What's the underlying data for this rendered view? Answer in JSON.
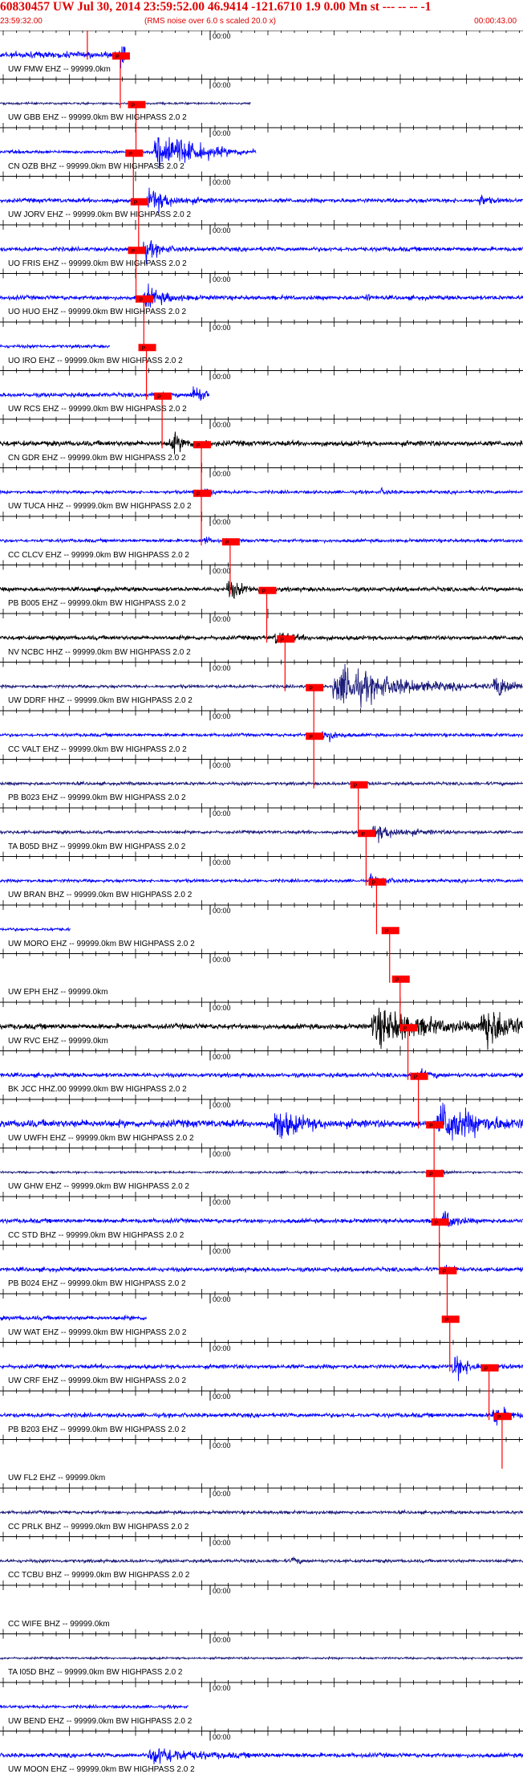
{
  "header": {
    "title": "60830457 UW Jul 30, 2014 23:59:52.00   46.9414 -121.6710  1.9 0.00 Mn st --- -- --   -1",
    "start_time": "23:59:32.00",
    "note": "(RMS noise over 6.0 s scaled 20.0 x)",
    "end_time": "00:00:43.00"
  },
  "chart_data": {
    "type": "line",
    "title": "60830457 UW Jul 30, 2014 23:59:52.00   46.9414 -121.6710  1.9 0.00 Mn st --- -- --   -1",
    "x_range": [
      "23:59:32.00",
      "00:00:43.00"
    ],
    "tick_label": "00:00",
    "pick_label": "P",
    "colors": {
      "pick": "#ff0000",
      "blue": "#0000ff",
      "black": "#000000",
      "navy": "#1a1a7a"
    },
    "traces": [
      {
        "label": "UW FMW EHZ -- 99999.0km",
        "color": "blue",
        "pick": 0.167,
        "amp": 6,
        "end": 0.24,
        "events": [
          [
            0.23,
            14,
            0.01
          ]
        ]
      },
      {
        "label": "UW GBB EHZ -- 99999.0km BW  HIGHPASS  2.0  2",
        "color": "navy",
        "pick": 0.23,
        "amp": 2,
        "end": 0.48,
        "events": []
      },
      {
        "label": "CN OZB BHZ -- 99999.0km BW  HIGHPASS  2.0  2",
        "color": "blue",
        "pick": 0.26,
        "amp": 3,
        "end": 0.49,
        "events": [
          [
            0.31,
            24,
            0.05
          ]
        ]
      },
      {
        "label": "UW JORV EHZ -- 99999.0km BW  HIGHPASS  2.0  2",
        "color": "blue",
        "pick": 0.255,
        "amp": 4,
        "end": 1.0,
        "events": [
          [
            0.29,
            12,
            0.03
          ],
          [
            0.92,
            6,
            0.01
          ]
        ]
      },
      {
        "label": "UO FRIS EHZ -- 99999.0km BW  HIGHPASS  2.0  2",
        "color": "blue",
        "pick": 0.265,
        "amp": 4,
        "end": 1.0,
        "events": [
          [
            0.28,
            10,
            0.02
          ]
        ]
      },
      {
        "label": "UO HUO EHZ -- 99999.0km BW  HIGHPASS  2.0  2",
        "color": "blue",
        "pick": 0.26,
        "amp": 4,
        "end": 1.0,
        "events": [
          [
            0.28,
            12,
            0.025
          ],
          [
            0.7,
            5,
            0.005
          ]
        ]
      },
      {
        "label": "UO IRO EHZ -- 99999.0km BW  HIGHPASS  2.0  2",
        "color": "blue",
        "pick": 0.275,
        "amp": 3,
        "end": 0.21,
        "events": []
      },
      {
        "label": "UW RCS EHZ -- 99999.0km BW  HIGHPASS  2.0  2",
        "color": "blue",
        "pick": 0.28,
        "amp": 4,
        "end": 0.4,
        "events": [
          [
            0.37,
            12,
            0.015
          ]
        ]
      },
      {
        "label": "CN GDR EHZ -- 99999.0km BW  HIGHPASS  2.0  2",
        "color": "black",
        "pick": 0.31,
        "amp": 5,
        "end": 1.0,
        "events": [
          [
            0.33,
            10,
            0.02
          ]
        ]
      },
      {
        "label": "UW TUCA HHZ -- 99999.0km BW  HIGHPASS  2.0  2",
        "color": "blue",
        "pick": 0.385,
        "amp": 3,
        "end": 1.0,
        "events": [
          [
            0.39,
            6,
            0.01
          ],
          [
            0.73,
            3,
            0.01
          ]
        ]
      },
      {
        "label": "CC CLCV EHZ -- 99999.0km BW  HIGHPASS  2.0  2",
        "color": "blue",
        "pick": 0.385,
        "amp": 3,
        "end": 1.0,
        "events": [
          [
            0.39,
            5,
            0.01
          ]
        ]
      },
      {
        "label": "PB B005 EHZ -- 99999.0km BW  HIGHPASS  2.0  2",
        "color": "black",
        "pick": 0.44,
        "amp": 4,
        "end": 1.0,
        "events": [
          [
            0.44,
            10,
            0.02
          ]
        ]
      },
      {
        "label": "NV NCBC HHZ -- 99999.0km BW  HIGHPASS  2.0  2",
        "color": "black",
        "pick": 0.51,
        "amp": 4,
        "end": 1.0,
        "events": [
          [
            0.53,
            8,
            0.02
          ]
        ]
      },
      {
        "label": "UW DDRF HHZ -- 99999.0km BW  HIGHPASS  2.0  2",
        "color": "navy",
        "pick": 0.545,
        "amp": 3,
        "end": 1.0,
        "events": [
          [
            0.66,
            22,
            0.08
          ],
          [
            0.95,
            14,
            0.02
          ]
        ]
      },
      {
        "label": "CC VALT EHZ -- 99999.0km BW  HIGHPASS  2.0  2",
        "color": "blue",
        "pick": 0.6,
        "amp": 3,
        "end": 1.0,
        "events": [
          [
            0.62,
            8,
            0.015
          ]
        ]
      },
      {
        "label": "PB B023 EHZ -- 99999.0km BW  HIGHPASS  2.0  2",
        "color": "navy",
        "pick": 0.6,
        "amp": 3,
        "end": 1.0,
        "events": []
      },
      {
        "label": "TA B05D BHZ -- 99999.0km BW  HIGHPASS  2.0  2",
        "color": "navy",
        "pick": 0.685,
        "amp": 3,
        "end": 1.0,
        "events": [
          [
            0.72,
            8,
            0.04
          ]
        ]
      },
      {
        "label": "UW BRAN BHZ -- 99999.0km BW  HIGHPASS  2.0  2",
        "color": "blue",
        "pick": 0.7,
        "amp": 3,
        "end": 1.0,
        "events": [
          [
            0.71,
            6,
            0.02
          ]
        ]
      },
      {
        "label": "UW MORO EHZ -- 99999.0km BW  HIGHPASS  2.0  2",
        "color": "blue",
        "pick": 0.72,
        "amp": 3,
        "end": 0.135,
        "events": []
      },
      {
        "label": "UW EPH EHZ -- 99999.0km",
        "color": "blue",
        "pick": 0.745,
        "amp": 0,
        "end": 0.0,
        "events": []
      },
      {
        "label": "UW RVC EHZ -- 99999.0km",
        "color": "black",
        "pick": 0.765,
        "amp": 5,
        "end": 1.0,
        "events": [
          [
            0.73,
            20,
            0.07
          ],
          [
            0.93,
            24,
            0.04
          ]
        ]
      },
      {
        "label": "BK JCC HHZ.00 99999.0km BW  HIGHPASS  2.0  2",
        "color": "blue",
        "pick": 0.78,
        "amp": 4,
        "end": 1.0,
        "events": [
          [
            0.8,
            6,
            0.015
          ]
        ]
      },
      {
        "label": "UW UWFH EHZ -- 99999.0km BW  HIGHPASS  2.0  2",
        "color": "blue",
        "pick": 0.8,
        "amp": 7,
        "end": 1.0,
        "events": [
          [
            0.53,
            18,
            0.03
          ],
          [
            0.85,
            22,
            0.05
          ]
        ]
      },
      {
        "label": "UW GHW EHZ -- 99999.0km BW  HIGHPASS  2.0  2",
        "color": "navy",
        "pick": 0.83,
        "amp": 2,
        "end": 1.0,
        "events": [
          [
            0.84,
            5,
            0.01
          ]
        ]
      },
      {
        "label": "CC STD BHZ -- 99999.0km BW  HIGHPASS  2.0  2",
        "color": "blue",
        "pick": 0.83,
        "amp": 4,
        "end": 1.0,
        "events": [
          [
            0.85,
            12,
            0.015
          ]
        ]
      },
      {
        "label": "PB B024 EHZ -- 99999.0km BW  HIGHPASS  2.0  2",
        "color": "blue",
        "pick": 0.84,
        "amp": 4,
        "end": 1.0,
        "events": [
          [
            0.85,
            8,
            0.01
          ]
        ]
      },
      {
        "label": "UW WAT EHZ -- 99999.0km BW  HIGHPASS  2.0  2",
        "color": "blue",
        "pick": 0.855,
        "amp": 4,
        "end": 0.28,
        "events": []
      },
      {
        "label": "UW CRF EHZ -- 99999.0km BW  HIGHPASS  2.0  2",
        "color": "blue",
        "pick": 0.86,
        "amp": 4,
        "end": 1.0,
        "events": [
          [
            0.87,
            14,
            0.02
          ]
        ]
      },
      {
        "label": "PB B203 EHZ -- 99999.0km BW  HIGHPASS  2.0  2",
        "color": "blue",
        "pick": 0.935,
        "amp": 4,
        "end": 1.0,
        "events": [
          [
            0.945,
            14,
            0.015
          ]
        ]
      },
      {
        "label": "UW FL2 EHZ -- 99999.0km",
        "color": "blue",
        "pick": 0.96,
        "amp": 0,
        "end": 0.0,
        "events": []
      },
      {
        "label": "CC PRLK BHZ -- 99999.0km BW  HIGHPASS  2.0  2",
        "color": "navy",
        "pick": null,
        "amp": 3,
        "end": 1.0,
        "events": []
      },
      {
        "label": "CC TCBU BHZ -- 99999.0km BW  HIGHPASS  2.0  2",
        "color": "navy",
        "pick": null,
        "amp": 3,
        "end": 1.0,
        "events": [
          [
            0.56,
            4,
            0.01
          ]
        ]
      },
      {
        "label": "CC WIFE BHZ -- 99999.0km",
        "color": "navy",
        "pick": null,
        "amp": 0,
        "end": 0.0,
        "events": []
      },
      {
        "label": "TA I05D BHZ -- 99999.0km BW  HIGHPASS  2.0  2",
        "color": "navy",
        "pick": null,
        "amp": 2,
        "end": 1.0,
        "events": []
      },
      {
        "label": "UW BEND EHZ -- 99999.0km BW  HIGHPASS  2.0  2",
        "color": "blue",
        "pick": null,
        "amp": 3,
        "end": 0.36,
        "events": []
      },
      {
        "label": "UW MOON EHZ -- 99999.0km BW  HIGHPASS  2.0  2",
        "color": "blue",
        "pick": null,
        "amp": 4,
        "end": 1.0,
        "events": [
          [
            0.3,
            10,
            0.05
          ]
        ]
      }
    ]
  }
}
